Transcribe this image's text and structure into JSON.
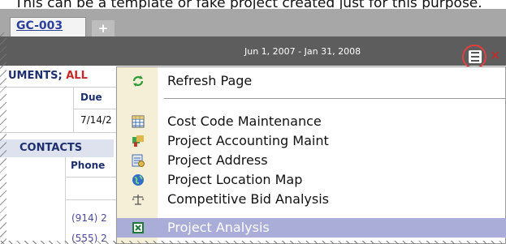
{
  "caption": "This can be a template or fake project created just for this purpose.",
  "tabs": {
    "active": "GC-003",
    "add": "+"
  },
  "header": {
    "date_range": "Jun 1, 2007 - Jan 31, 2008"
  },
  "icons": {
    "menu": "hamburger-menu-icon",
    "close": "close-icon"
  },
  "background": {
    "documents_header": "UMENTS;",
    "documents_all": "ALL",
    "due_header": "Due",
    "due_value": "7/14/2",
    "contacts_header": "CONTACTS",
    "phone_header": "Phone",
    "phone_1": "(914) 2",
    "phone_2": "(555) 2"
  },
  "menu": {
    "items": [
      {
        "label": "Refresh Page",
        "icon": "refresh-icon"
      },
      {
        "label": "Cost Code Maintenance",
        "icon": "grid-icon"
      },
      {
        "label": "Project Accounting Maint",
        "icon": "accounting-icon"
      },
      {
        "label": "Project Address",
        "icon": "address-icon"
      },
      {
        "label": "Project Location Map",
        "icon": "globe-icon"
      },
      {
        "label": "Competitive Bid Analysis",
        "icon": "scales-icon"
      },
      {
        "label": "Project Analysis",
        "icon": "spreadsheet-icon",
        "highlighted": true
      }
    ]
  },
  "colors": {
    "highlight": "#a9add8",
    "annotation_circle": "#e23f3f",
    "tab_link": "#2b3f9d"
  }
}
